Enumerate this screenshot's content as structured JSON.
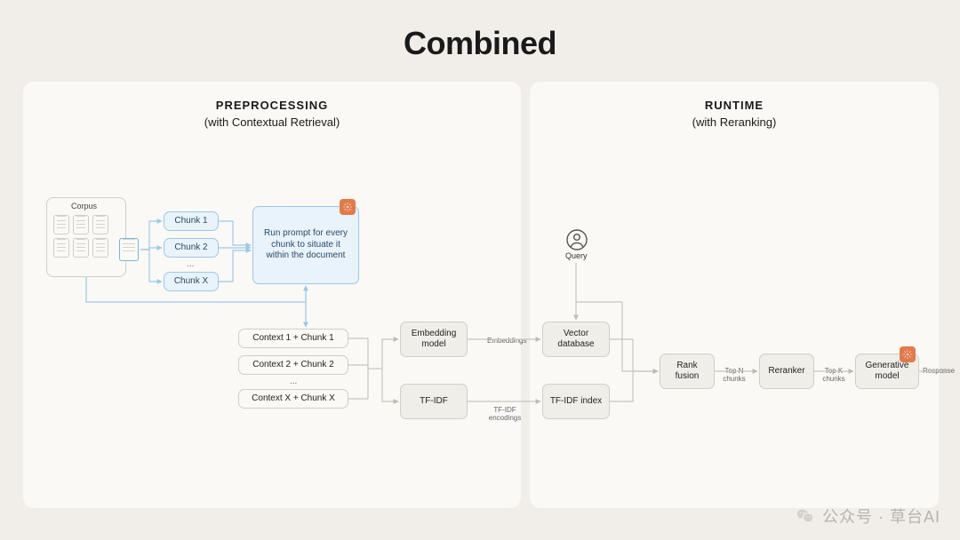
{
  "title": "Combined",
  "panels": {
    "left": {
      "heading": "PREPROCESSING",
      "sub": "(with Contextual Retrieval)"
    },
    "right": {
      "heading": "RUNTIME",
      "sub": "(with Reranking)"
    }
  },
  "corpus": {
    "label": "Corpus"
  },
  "chunks": {
    "c1": "Chunk 1",
    "c2": "Chunk 2",
    "ell": "...",
    "cx": "Chunk X"
  },
  "prompt_box": "Run prompt for every chunk to situate it within the document",
  "contexts": {
    "c1": "Context 1 + Chunk 1",
    "c2": "Context 2 + Chunk 2",
    "ell": "...",
    "cx": "Context X + Chunk X"
  },
  "embed_model": "Embedding model",
  "tfidf": "TF-IDF",
  "vector_db": "Vector database",
  "tfidf_index": "TF-IDF index",
  "query": "Query",
  "rank_fusion": "Rank fusion",
  "reranker": "Reranker",
  "gen_model": "Generative model",
  "labels": {
    "embeddings": "Embeddings",
    "tfidf_enc": "TF-IDF encodings",
    "topn": "Top N chunks",
    "topk": "Top K chunks",
    "response": "Response"
  },
  "watermark": "公众号 · 草台AI"
}
